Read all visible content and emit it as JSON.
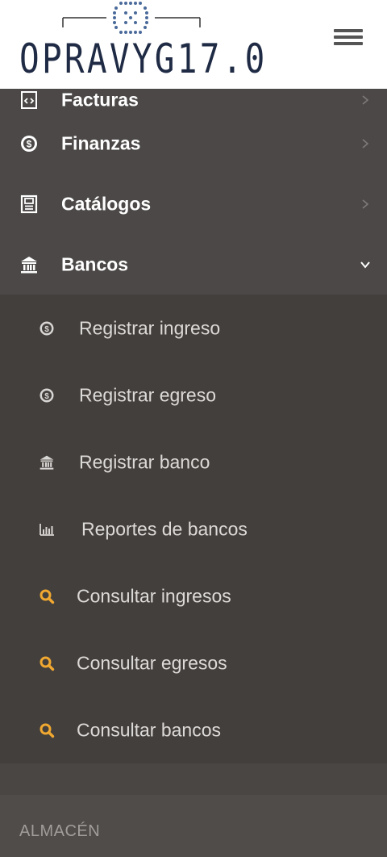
{
  "brand": {
    "logo_text": "OPRAVYG17.0"
  },
  "nav": {
    "items": [
      {
        "label": "Facturas",
        "icon": "invoice-icon"
      },
      {
        "label": "Finanzas",
        "icon": "dollar-circle-icon"
      },
      {
        "label": "Catálogos",
        "icon": "catalog-icon"
      },
      {
        "label": "Bancos",
        "icon": "bank-icon",
        "expanded": true
      }
    ],
    "bancos_submenu": [
      {
        "label": "Registrar ingreso",
        "icon": "dollar-circle-icon"
      },
      {
        "label": "Registrar egreso",
        "icon": "dollar-circle-icon"
      },
      {
        "label": "Registrar banco",
        "icon": "bank-icon"
      },
      {
        "label": "Reportes de bancos",
        "icon": "bar-chart-icon"
      },
      {
        "label": "Consultar ingresos",
        "icon": "search-icon"
      },
      {
        "label": "Consultar egresos",
        "icon": "search-icon"
      },
      {
        "label": "Consultar bancos",
        "icon": "search-icon"
      }
    ],
    "section_header": "ALMACÉN"
  },
  "colors": {
    "accent_search": "#f0a830",
    "sidebar_bg": "#4b4847",
    "submenu_bg": "#433f3d"
  }
}
